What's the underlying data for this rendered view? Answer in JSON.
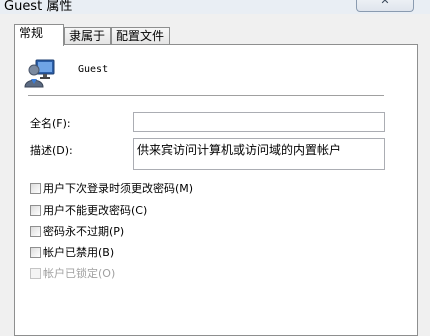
{
  "window": {
    "title": "Guest 属性",
    "close_glyph": "✕"
  },
  "tabs": [
    {
      "label": "常规",
      "active": true
    },
    {
      "label": "隶属于",
      "active": false
    },
    {
      "label": "配置文件",
      "active": false
    }
  ],
  "general": {
    "username": "Guest",
    "avatar_icon": "user-account-icon",
    "fullname_label": "全名(F):",
    "fullname_value": "",
    "description_label": "描述(D):",
    "description_value": "供来宾访问计算机或访问域的内置帐户",
    "options": [
      {
        "label": "用户下次登录时须更改密码(M)",
        "checked": false,
        "enabled": true
      },
      {
        "label": "用户不能更改密码(C)",
        "checked": false,
        "enabled": true
      },
      {
        "label": "密码永不过期(P)",
        "checked": false,
        "enabled": true
      },
      {
        "label": "帐户已禁用(B)",
        "checked": false,
        "enabled": true
      },
      {
        "label": "帐户已锁定(O)",
        "checked": false,
        "enabled": false
      }
    ]
  }
}
